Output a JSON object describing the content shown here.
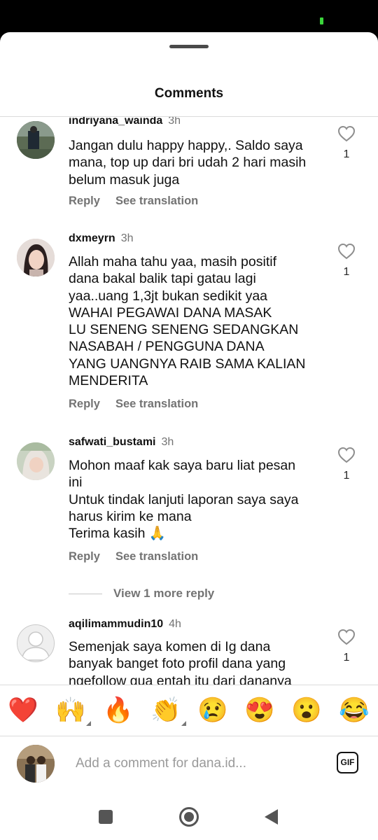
{
  "sheet": {
    "title": "Comments"
  },
  "comments": [
    {
      "username": "indriyana_wainda",
      "time": "3h",
      "text": "Jangan dulu happy happy,. Saldo saya\nmana, top up dari bri udah 2 hari masih\nbelum masuk juga",
      "likes": "1"
    },
    {
      "username": "dxmeyrn",
      "time": "3h",
      "text": "Allah maha tahu yaa, masih positif\ndana bakal balik tapi gatau lagi\nyaa..uang 1,3jt bukan sedikit yaa\nWAHAI PEGAWAI DANA MASAK\nLU SENENG SENENG SEDANGKAN\nNASABAH / PENGGUNA DANA\nYANG UANGNYA RAIB SAMA KALIAN\nMENDERITA",
      "likes": "1"
    },
    {
      "username": "safwati_bustami",
      "time": "3h",
      "text": "Mohon maaf kak saya baru liat pesan\nini\nUntuk tindak lanjuti laporan saya saya\nharus kirim ke mana\nTerima kasih 🙏",
      "likes": "1"
    },
    {
      "username": "aqilimammudin10",
      "time": "4h",
      "text": "Semenjak saya komen di Ig dana\nbanyak banget foto profil dana yang\nngefollow gua entah itu dari dananya",
      "likes": "1"
    }
  ],
  "actions": {
    "reply": "Reply",
    "see_translation": "See translation"
  },
  "view_more_replies": "View 1 more reply",
  "emoji_bar": [
    "❤️",
    "🙌",
    "🔥",
    "👏",
    "😢",
    "😍",
    "😮",
    "😂"
  ],
  "composer": {
    "placeholder": "Add a comment for dana.id...",
    "gif_label": "GIF"
  },
  "icons": {
    "like": "heart-outline-icon",
    "gif": "gif-icon",
    "nav_recents": "square-icon",
    "nav_home": "circle-icon",
    "nav_back": "triangle-back-icon"
  }
}
